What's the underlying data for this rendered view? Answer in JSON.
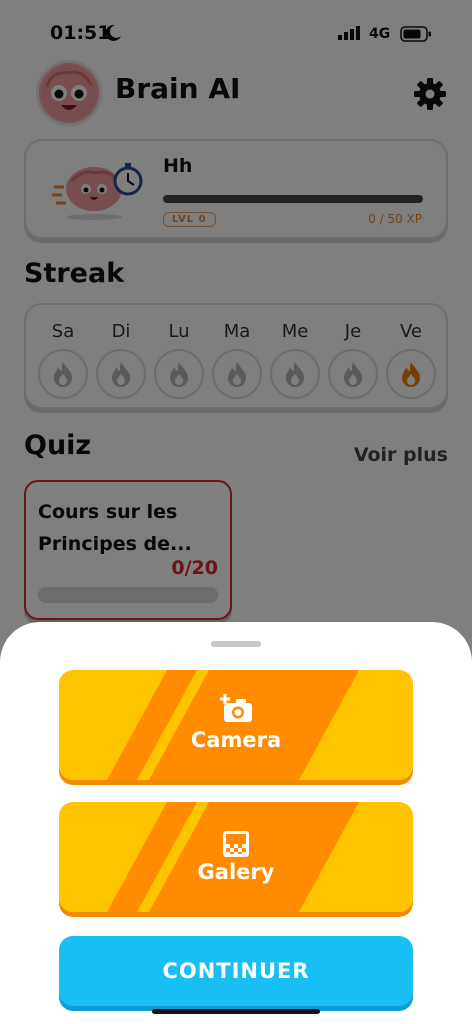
{
  "status_bar": {
    "time": "01:51",
    "network": "4G",
    "icons": [
      "moon-icon",
      "signal-icon",
      "battery-icon"
    ]
  },
  "header": {
    "app_title": "Brain AI",
    "settings_icon": "gear-icon"
  },
  "profile": {
    "name": "Hh",
    "level_badge": "LVL 0",
    "xp_text": "0 / 50 XP",
    "xp_progress": 0
  },
  "streak": {
    "title": "Streak",
    "days": [
      {
        "label": "Sa",
        "active": false
      },
      {
        "label": "Di",
        "active": false
      },
      {
        "label": "Lu",
        "active": false
      },
      {
        "label": "Ma",
        "active": false
      },
      {
        "label": "Me",
        "active": false
      },
      {
        "label": "Je",
        "active": false
      },
      {
        "label": "Ve",
        "active": true
      }
    ]
  },
  "quiz": {
    "title": "Quiz",
    "see_more": "Voir plus",
    "items": [
      {
        "name": "Cours sur les Principes de...",
        "score": "0/20",
        "progress": 0
      }
    ]
  },
  "sheet": {
    "camera_label": "Camera",
    "gallery_label": "Galery",
    "continue_label": "CONTINUER"
  },
  "colors": {
    "accent_orange": "#ff8c00",
    "accent_yellow": "#ffc400",
    "continue_blue": "#18bff5",
    "quiz_red": "#d9262c",
    "flame_active": "#f07c12"
  }
}
